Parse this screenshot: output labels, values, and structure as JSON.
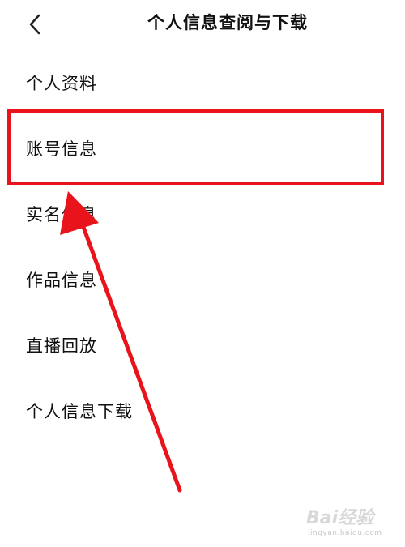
{
  "header": {
    "title": "个人信息查阅与下载",
    "back_icon": "chevron-left-icon"
  },
  "menu": {
    "items": [
      {
        "label": "个人资料"
      },
      {
        "label": "账号信息"
      },
      {
        "label": "实名信息"
      },
      {
        "label": "作品信息"
      },
      {
        "label": "直播回放"
      },
      {
        "label": "个人信息下载"
      }
    ]
  },
  "annotation": {
    "highlight_color": "#e8131b",
    "highlighted_item": "账号信息"
  },
  "watermark": {
    "brand": "Bai经验",
    "url": "jingyan.baidu.com"
  }
}
